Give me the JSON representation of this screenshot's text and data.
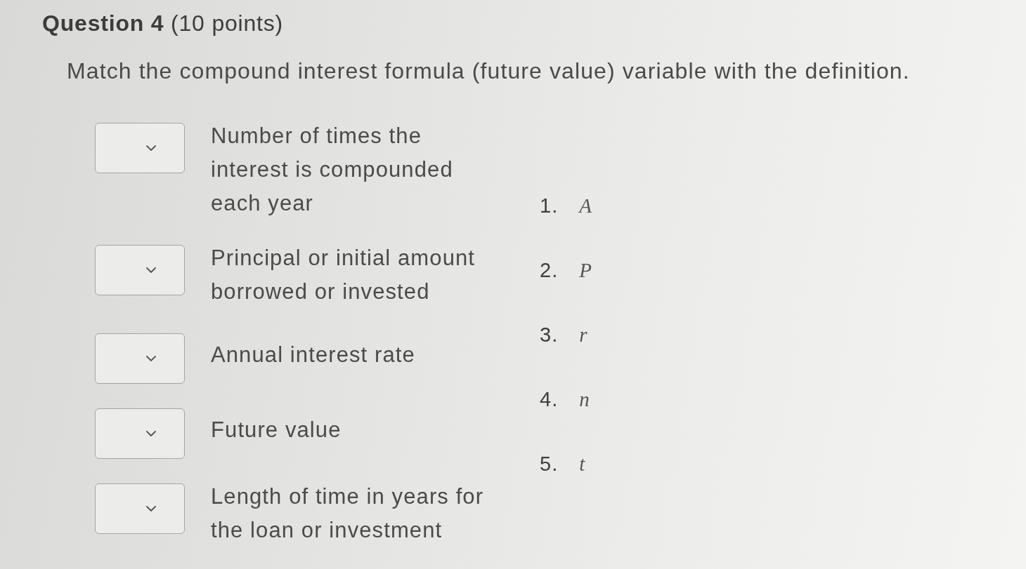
{
  "question": {
    "title": "**Question 4** (10 points)",
    "prompt": "Match the compound interest formula (future value) variable with the definition."
  },
  "matches": [
    {
      "definition": "Number of times the interest is compounded each year"
    },
    {
      "definition": "Principal or initial amount borrowed or invested"
    },
    {
      "definition": "Annual interest rate"
    },
    {
      "definition": "Future value"
    },
    {
      "definition": "Length of time in years for the loan or investment"
    }
  ],
  "options": [
    {
      "number": "1.",
      "variable": "A"
    },
    {
      "number": "2.",
      "variable": "P"
    },
    {
      "number": "3.",
      "variable": "r"
    },
    {
      "number": "4.",
      "variable": "n"
    },
    {
      "number": "5.",
      "variable": "t"
    }
  ]
}
